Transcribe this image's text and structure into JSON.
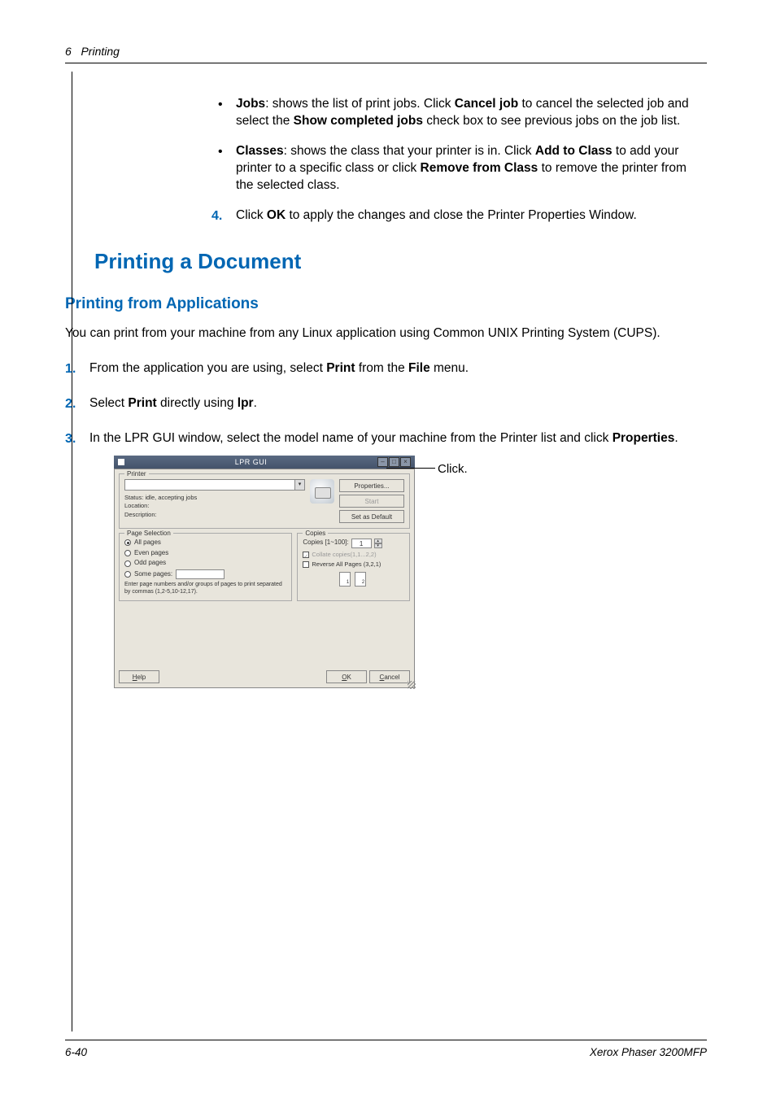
{
  "header": {
    "page_num": "6",
    "chapter": "Printing"
  },
  "bullets": [
    {
      "name": "Jobs",
      "text": ": shows the list of print jobs. Click ",
      "action1": "Cancel job",
      "text2": " to cancel the selected job and select the ",
      "action2": "Show completed jobs",
      "text3": " check box to see previous jobs on the job list."
    },
    {
      "name": "Classes",
      "text": ": shows the class that your printer is in. Click ",
      "action1": "Add to Class",
      "text2": " to add your printer to a specific class or click ",
      "action2": "Remove from Class",
      "text3": " to remove the printer from the selected class."
    }
  ],
  "step4": {
    "num": "4.",
    "pre": "Click ",
    "action": "OK",
    "post": " to apply the changes and close the Printer Properties Window."
  },
  "h1": "Printing a Document",
  "h2": "Printing from Applications",
  "intro": "You can print from your machine from any Linux application using Common UNIX Printing System (CUPS).",
  "steps": [
    {
      "num": "1.",
      "pre": "From the application you are using, select ",
      "b1": "Print",
      "mid": " from the ",
      "b2": "File",
      "post": " menu."
    },
    {
      "num": "2.",
      "pre": "Select ",
      "b1": "Print",
      "mid": " directly using ",
      "b2": "lpr",
      "post": "."
    },
    {
      "num": "3.",
      "pre": "In the LPR GUI window, select the model name of your machine from the Printer list and click ",
      "b1": "Properties",
      "post": "."
    }
  ],
  "lpr": {
    "title": "LPR GUI",
    "printer_legend": "Printer",
    "status_label": "Status:",
    "status_value": "idle, accepting jobs",
    "location_label": "Location:",
    "description_label": "Description:",
    "btn_properties": "Properties...",
    "btn_start": "Start",
    "btn_default": "Set as Default",
    "page_legend": "Page Selection",
    "radio_all": "All pages",
    "radio_even": "Even pages",
    "radio_odd": "Odd pages",
    "radio_some": "Some pages:",
    "hint": "Enter page numbers and/or groups of pages to print separated by commas (1,2-5,10-12,17).",
    "copies_legend": "Copies",
    "copies_label": "Copies [1~100]:",
    "copies_value": "1",
    "collate": "Collate copies(1,1...2,2)",
    "reverse": "Reverse All Pages (3,2,1)",
    "btn_help": "Help",
    "btn_ok": "OK",
    "btn_cancel": "Cancel"
  },
  "callout": "Click.",
  "footer": {
    "page": "6-40",
    "product": "Xerox Phaser 3200MFP"
  }
}
